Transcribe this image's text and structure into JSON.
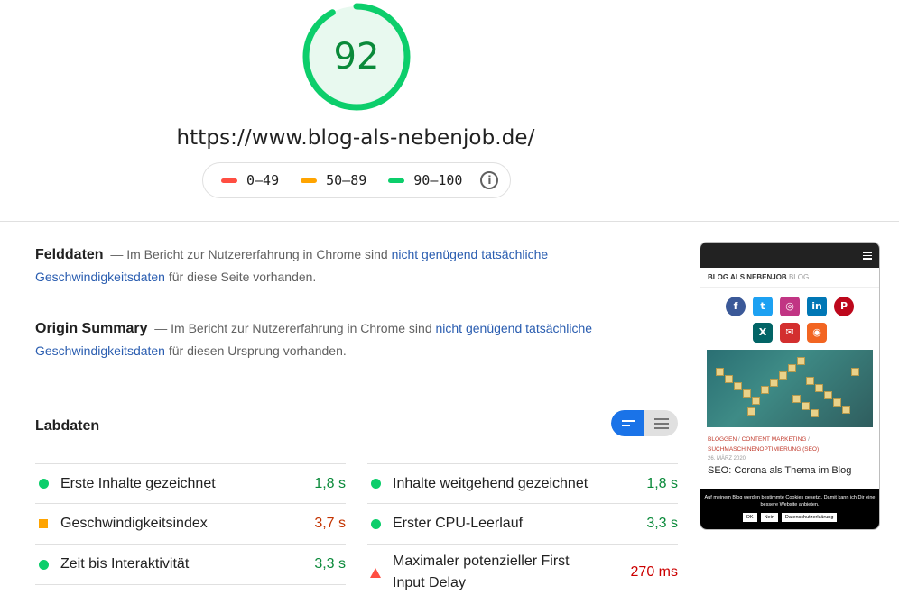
{
  "score": {
    "value": "92",
    "fraction": 0.92,
    "color": "#0cce6b"
  },
  "url": "https://www.blog-als-nebenjob.de/",
  "legend": [
    {
      "range": "0–49",
      "color": "#ff4e42"
    },
    {
      "range": "50–89",
      "color": "#ffa400"
    },
    {
      "range": "90–100",
      "color": "#0cce6b"
    }
  ],
  "legend_info_icon": "i",
  "felddaten": {
    "heading": "Felddaten",
    "dash": "—",
    "text_before": "Im Bericht zur Nutzererfahrung in Chrome sind",
    "link": "nicht genügend tatsächliche Geschwindigkeitsdaten",
    "text_after": "für diese Seite vorhanden."
  },
  "origin": {
    "heading": "Origin Summary",
    "dash": "—",
    "text_before": "Im Bericht zur Nutzererfahrung in Chrome sind",
    "link": "nicht genügend tatsächliche Geschwindigkeitsdaten",
    "text_after": "für diesen Ursprung vorhanden."
  },
  "labdaten": {
    "heading": "Labdaten"
  },
  "metrics": [
    {
      "label": "Erste Inhalte gezeichnet",
      "value": "1,8 s",
      "status": "pass"
    },
    {
      "label": "Inhalte weitgehend gezeichnet",
      "value": "1,8 s",
      "status": "pass"
    },
    {
      "label": "Geschwindigkeitsindex",
      "value": "3,7 s",
      "status": "average"
    },
    {
      "label": "Erster CPU-Leerlauf",
      "value": "3,3 s",
      "status": "pass"
    },
    {
      "label": "Zeit bis Interaktivität",
      "value": "3,3 s",
      "status": "pass"
    },
    {
      "label": "Maximaler potenzieller First Input Delay",
      "value": "270 ms",
      "status": "fail"
    }
  ],
  "phone": {
    "blog_title": "BLOG ALS NEBENJOB",
    "blog_title_suffix": "BLOG",
    "social_icons": [
      {
        "name": "facebook-icon",
        "glyph": "f",
        "color": "#3b5998"
      },
      {
        "name": "twitter-icon",
        "glyph": "t",
        "color": "#1da1f2"
      },
      {
        "name": "instagram-icon",
        "glyph": "◎",
        "color": "#c13584"
      },
      {
        "name": "linkedin-icon",
        "glyph": "in",
        "color": "#0077b5"
      },
      {
        "name": "pinterest-icon",
        "glyph": "P",
        "color": "#bd081c"
      },
      {
        "name": "xing-icon",
        "glyph": "X",
        "color": "#026466"
      },
      {
        "name": "email-icon",
        "glyph": "✉",
        "color": "#d32f2f"
      },
      {
        "name": "rss-icon",
        "glyph": "◉",
        "color": "#f26522"
      }
    ],
    "categories": [
      "BLOGGEN",
      "CONTENT MARKETING",
      "SUCHMASCHINENOPTIMIERUNG (SEO)"
    ],
    "date": "26. MÄRZ 2020",
    "post_title": "SEO: Corona als Thema im Blog",
    "cookie_text": "Auf meinem Blog werden bestimmte Cookies gesetzt. Damit kann ich Dir eine bessere Website anbieten.",
    "cookie_buttons": [
      "OK",
      "Nein",
      "Datenschutzerklärung"
    ]
  }
}
